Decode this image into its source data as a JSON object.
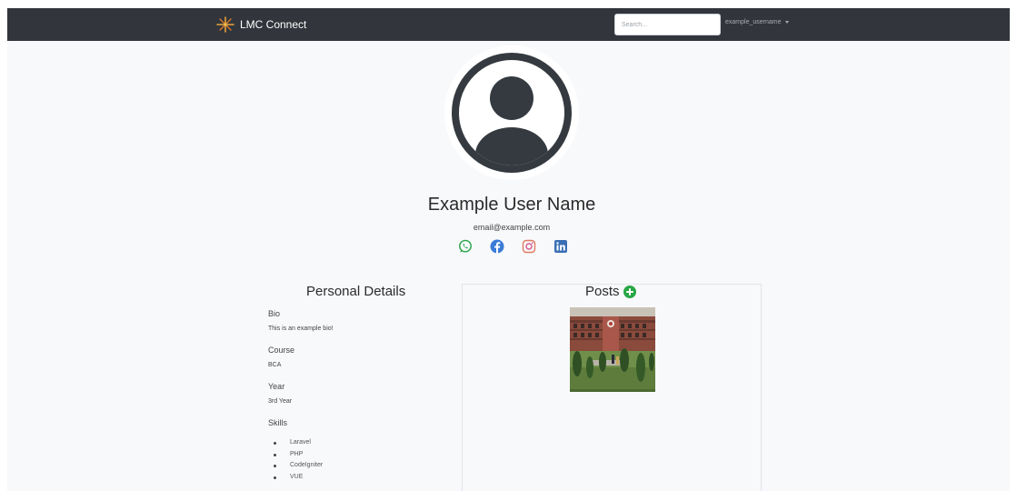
{
  "navbar": {
    "brand_name": "LMC Connect",
    "search_placeholder": "Search...",
    "username": "example_username"
  },
  "profile": {
    "name": "Example User Name",
    "email": "email@example.com",
    "socials": [
      {
        "icon": "whatsapp-icon",
        "color": "#25a244"
      },
      {
        "icon": "facebook-icon",
        "color": "#3b7bd6"
      },
      {
        "icon": "instagram-icon",
        "color": "#e07a5f"
      },
      {
        "icon": "linkedin-icon",
        "color": "#3a6fb5"
      }
    ]
  },
  "personal_details": {
    "title": "Personal Details",
    "bio_label": "Bio",
    "bio_value": "This is an example bio!",
    "course_label": "Course",
    "course_value": "BCA",
    "year_label": "Year",
    "year_value": "3rd Year",
    "skills_label": "Skills",
    "skills": [
      "Laravel",
      "PHP",
      "CodeIgniter",
      "VUE"
    ]
  },
  "posts": {
    "title": "Posts"
  },
  "colors": {
    "navbar_bg": "#32363c",
    "page_bg": "#f8f9fb",
    "accent_green": "#28a745",
    "avatar_dark": "#343a40"
  }
}
